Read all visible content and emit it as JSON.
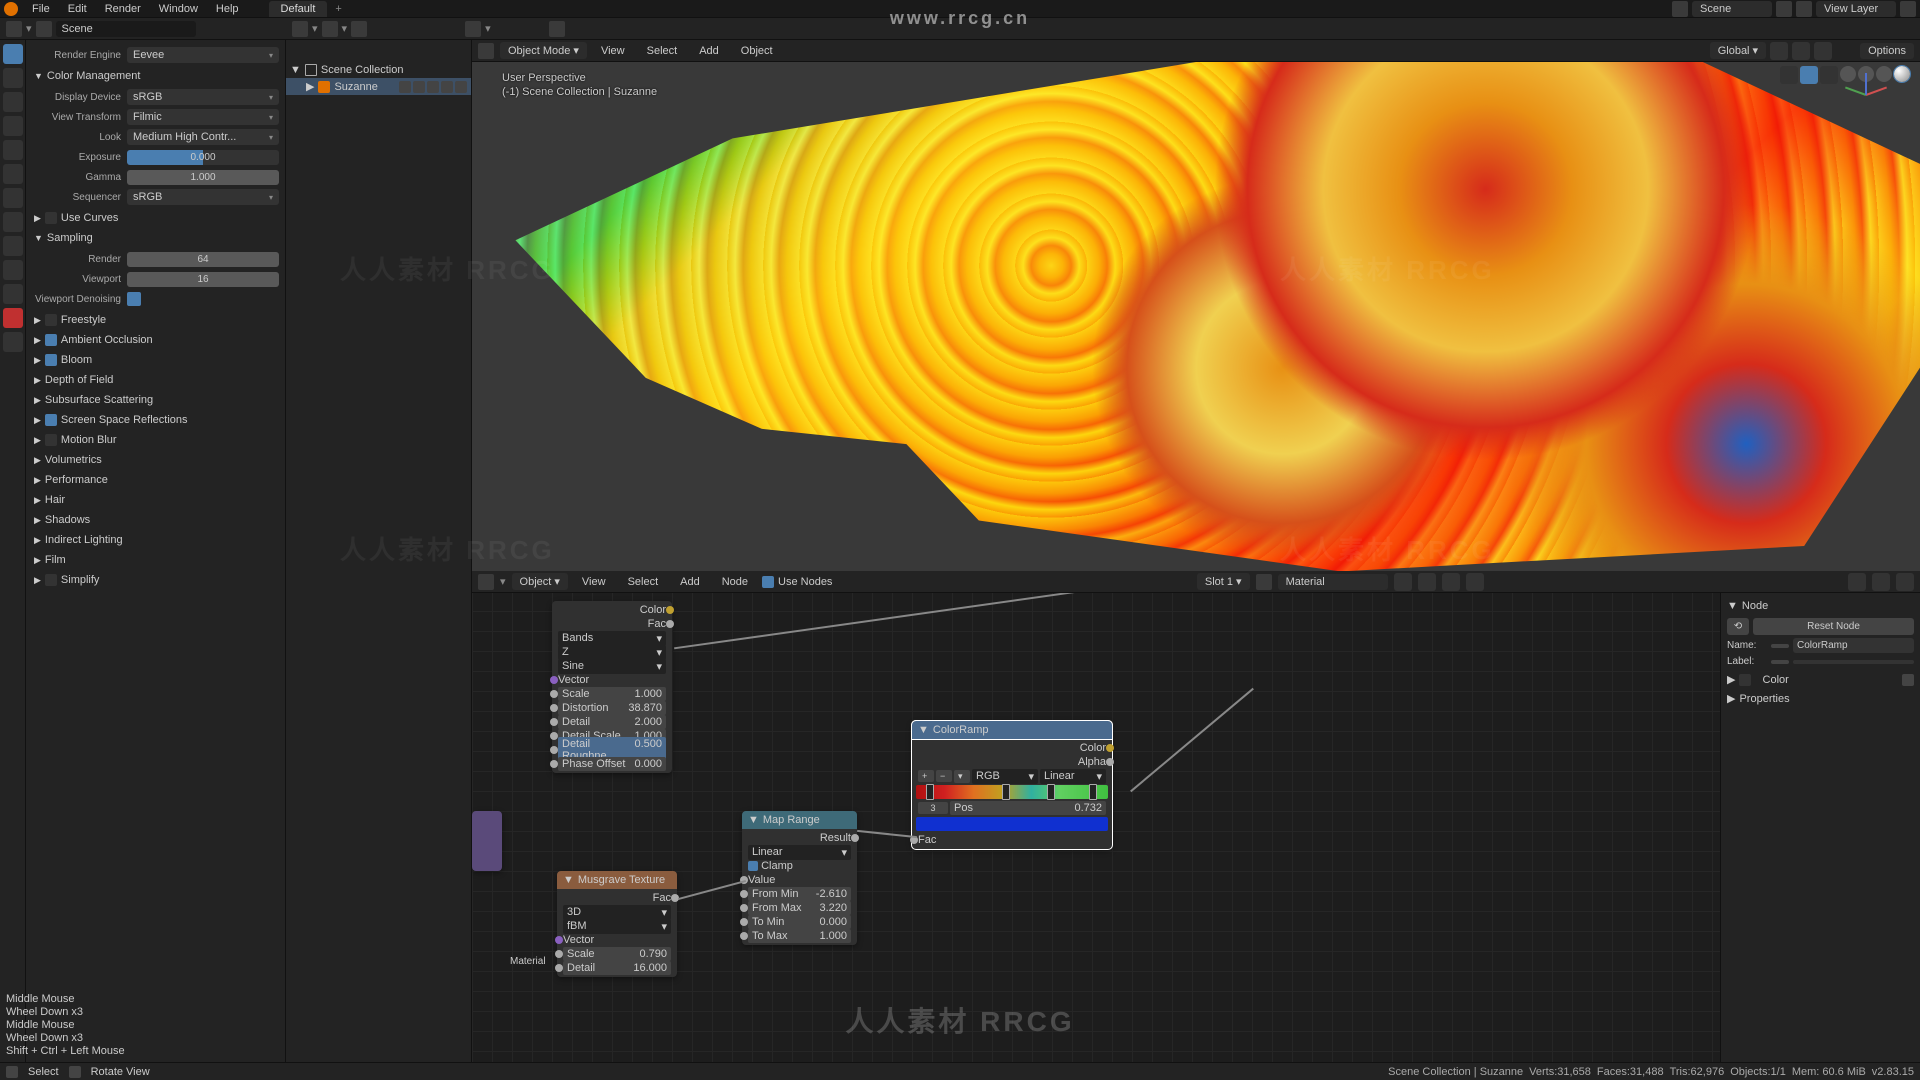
{
  "top_menu": {
    "items": [
      "File",
      "Edit",
      "Render",
      "Window",
      "Help"
    ],
    "workspace": "Default",
    "scene": "Scene",
    "layer": "View Layer"
  },
  "secondary": {
    "scene_field": "Scene"
  },
  "render_props": {
    "engine_label": "Render Engine",
    "engine_value": "Eevee",
    "color_mgmt": "Color Management",
    "device_label": "Display Device",
    "device_value": "sRGB",
    "vt_label": "View Transform",
    "vt_value": "Filmic",
    "look_label": "Look",
    "look_value": "Medium High Contr...",
    "exposure_label": "Exposure",
    "exposure_value": "0.000",
    "gamma_label": "Gamma",
    "gamma_value": "1.000",
    "sequencer_label": "Sequencer",
    "sequencer_value": "sRGB",
    "use_curves": "Use Curves",
    "sampling": "Sampling",
    "render_label": "Render",
    "render_value": "64",
    "viewport_label": "Viewport",
    "viewport_value": "16",
    "vp_denoise": "Viewport Denoising",
    "sections": [
      "Freestyle",
      "Ambient Occlusion",
      "Bloom",
      "Depth of Field",
      "Subsurface Scattering",
      "Screen Space Reflections",
      "Motion Blur",
      "Volumetrics",
      "Performance",
      "Hair",
      "Shadows",
      "Indirect Lighting",
      "Film",
      "Simplify"
    ]
  },
  "outliner": {
    "scene_collection": "Scene Collection",
    "object": "Suzanne"
  },
  "viewport": {
    "mode": "Object Mode",
    "menus": [
      "View",
      "Select",
      "Add",
      "Object"
    ],
    "orient": "Global",
    "overlay1": "User Perspective",
    "overlay2": "(-1) Scene Collection | Suzanne"
  },
  "node_editor": {
    "type": "Object",
    "menus": [
      "View",
      "Select",
      "Add",
      "Node"
    ],
    "use_nodes": "Use Nodes",
    "slot": "Slot 1",
    "material": "Material",
    "options": "Options",
    "material_label": "Material"
  },
  "nodes": {
    "wave": {
      "out_color": "Color",
      "out_fac": "Fac",
      "bands": "Bands",
      "axis": "Z",
      "profile": "Sine",
      "vector": "Vector",
      "scale_l": "Scale",
      "scale_v": "1.000",
      "dist_l": "Distortion",
      "dist_v": "38.870",
      "det_l": "Detail",
      "det_v": "2.000",
      "detsc_l": "Detail Scale",
      "detsc_v": "1.000",
      "detr_l": "Detail Roughne",
      "detr_v": "0.500",
      "ph_l": "Phase Offset",
      "ph_v": "0.000"
    },
    "maprange": {
      "title": "Map Range",
      "result": "Result",
      "interp": "Linear",
      "clamp": "Clamp",
      "value": "Value",
      "fmin_l": "From Min",
      "fmin_v": "-2.610",
      "fmax_l": "From Max",
      "fmax_v": "3.220",
      "tmin_l": "To Min",
      "tmin_v": "0.000",
      "tmax_l": "To Max",
      "tmax_v": "1.000"
    },
    "colorramp": {
      "title": "ColorRamp",
      "out_color": "Color",
      "out_alpha": "Alpha",
      "mode": "RGB",
      "interp": "Linear",
      "idx": "3",
      "pos_l": "Pos",
      "pos_v": "0.732",
      "fac": "Fac"
    },
    "musgrave": {
      "title": "Musgrave Texture",
      "out_fac": "Fac",
      "dim": "3D",
      "type": "fBM",
      "vector": "Vector",
      "scale_l": "Scale",
      "scale_v": "0.790",
      "det_l": "Detail",
      "det_v": "16.000"
    }
  },
  "node_panel": {
    "title": "Node",
    "reset": "Reset Node",
    "name_l": "Name:",
    "name_v": "ColorRamp",
    "label_l": "Label:",
    "label_v": "",
    "sections": [
      "Color",
      "Properties"
    ]
  },
  "kb_log": [
    "Middle Mouse",
    "Wheel Down x3",
    "Middle Mouse",
    "Wheel Down x3",
    "Shift + Ctrl + Left Mouse"
  ],
  "statusbar": {
    "select": "Select",
    "rotate": "Rotate View",
    "context": "Scene Collection | Suzanne",
    "verts": "Verts:31,658",
    "faces": "Faces:31,488",
    "tris": "Tris:62,976",
    "objects": "Objects:1/1",
    "mem": "Mem: 60.6 MiB",
    "ver": "v2.83.15"
  },
  "watermark_url": "www.rrcg.cn",
  "watermark_text": "人人素材 RRCG"
}
